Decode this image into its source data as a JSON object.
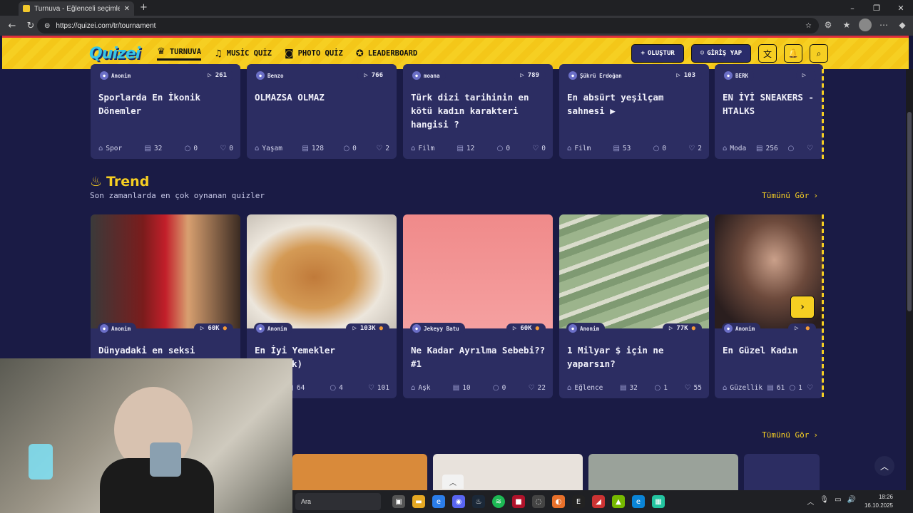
{
  "browser": {
    "tab_title": "Turnuva - Eğlenceli seçimler yap",
    "url": "https://quizei.com/tr/tournament"
  },
  "header": {
    "logo": "Quizei",
    "menu": [
      {
        "label": "TURNUVA",
        "icon": "trophy-icon"
      },
      {
        "label": "MUSİC QUİZ",
        "icon": "music-icon"
      },
      {
        "label": "PHOTO QUİZ",
        "icon": "camera-icon"
      },
      {
        "label": "LEADERBOARD",
        "icon": "medal-icon"
      }
    ],
    "create_label": "OLUŞTUR",
    "login_label": "GİRİŞ YAP"
  },
  "top_row": [
    {
      "author": "Anonim",
      "plays": "261",
      "title": "Sporlarda En İkonik Dönemler",
      "category": "Spor",
      "questions": "32",
      "comments": "0",
      "likes": "0"
    },
    {
      "author": "Benzo",
      "plays": "766",
      "title": "OLMAZSA OLMAZ",
      "category": "Yaşam",
      "questions": "128",
      "comments": "0",
      "likes": "2"
    },
    {
      "author": "moana",
      "plays": "789",
      "title": "Türk dizi tarihinin en kötü kadın karakteri hangisi ?",
      "category": "Film",
      "questions": "12",
      "comments": "0",
      "likes": "0"
    },
    {
      "author": "Şükrü Erdoğan",
      "plays": "103",
      "title": "En absürt yeşilçam sahnesi ▶",
      "category": "Film",
      "questions": "53",
      "comments": "0",
      "likes": "2"
    },
    {
      "author": "BERK",
      "plays": "",
      "title": "EN İYİ SNEAKERS - HTALKS",
      "category": "Moda",
      "questions": "256",
      "comments": "",
      "likes": ""
    }
  ],
  "trend": {
    "title": "Trend",
    "subtitle": "Son zamanlarda en çok oynanan quizler",
    "see_all": "Tümünü Gör",
    "cards": [
      {
        "author": "Anonim",
        "plays": "60K",
        "title": "Dünyadaki en seksi",
        "category": "",
        "questions": "",
        "comments": "",
        "likes": ""
      },
      {
        "author": "Anonim",
        "plays": "103K",
        "title": "En İyi Yemekler",
        "title2": "k)",
        "category": "",
        "questions": "64",
        "comments": "4",
        "likes": "101"
      },
      {
        "author": "Jekeyy Batu",
        "plays": "60K",
        "title": "Ne Kadar Ayrılma Sebebi?? #1",
        "category": "Aşk",
        "questions": "10",
        "comments": "0",
        "likes": "22"
      },
      {
        "author": "Anonim",
        "plays": "77K",
        "title": "1 Milyar $ için ne yaparsın?",
        "category": "Eğlence",
        "questions": "32",
        "comments": "1",
        "likes": "55"
      },
      {
        "author": "Anonim",
        "plays": "",
        "title": "En Güzel Kadın",
        "category": "Güzellik",
        "questions": "61",
        "comments": "1",
        "likes": ""
      }
    ]
  },
  "next_section": {
    "see_all": "Tümünü Gör"
  },
  "taskbar": {
    "search": "Ara",
    "time": "18:26",
    "date": "16.10.2025"
  }
}
